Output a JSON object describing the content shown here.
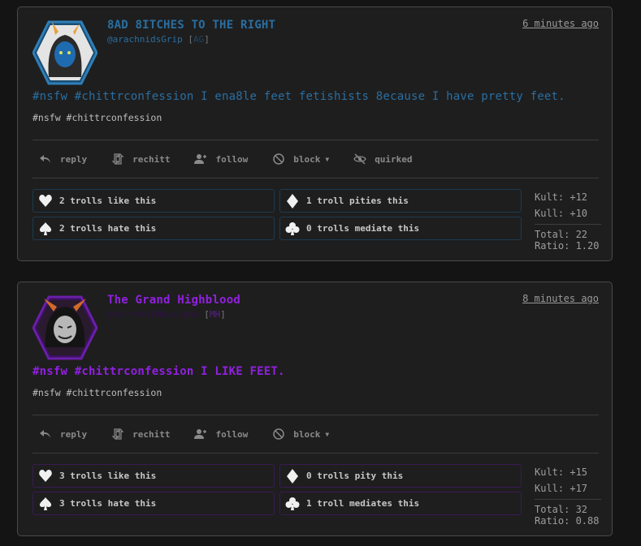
{
  "colors": {
    "post1_accent": "#2a6ea0",
    "post2_accent": "#9120e0"
  },
  "posts": [
    {
      "display_name": "8AD 8ITCHES TO THE RIGHT",
      "handle": "@arachnidsGrip",
      "initials": "AG",
      "timestamp": "6 minutes ago",
      "body": "#nsfw #chittrconfession I ena8le feet fetishists 8ecause I have pretty feet.",
      "tags": "#nsfw #chittrconfession",
      "actions": {
        "reply": "reply",
        "rechitt": "rechitt",
        "follow": "follow",
        "block": "block",
        "quirked": "quirked"
      },
      "reactions": {
        "like": "2 trolls like this",
        "pity": "1 troll pities this",
        "hate": "2 trolls hate this",
        "mediate": "0 trolls mediate this"
      },
      "stats": {
        "kult": "Kult: +12",
        "kull": "Kull: +10",
        "total": "Total: 22",
        "ratio": "Ratio: 1.20"
      }
    },
    {
      "display_name": "The Grand Highblood",
      "handle": "@mirthfulMessiahs",
      "initials": "MH",
      "timestamp": "8 minutes ago",
      "body": "#nsfw #chittrconfession I LIKE FEET.",
      "tags": "#nsfw #chittrconfession",
      "actions": {
        "reply": "reply",
        "rechitt": "rechitt",
        "follow": "follow",
        "block": "block"
      },
      "reactions": {
        "like": "3 trolls like this",
        "pity": "0 trolls pity this",
        "hate": "3 trolls hate this",
        "mediate": "1 troll mediates this"
      },
      "stats": {
        "kult": "Kult: +15",
        "kull": "Kull: +17",
        "total": "Total: 32",
        "ratio": "Ratio: 0.88"
      }
    }
  ]
}
